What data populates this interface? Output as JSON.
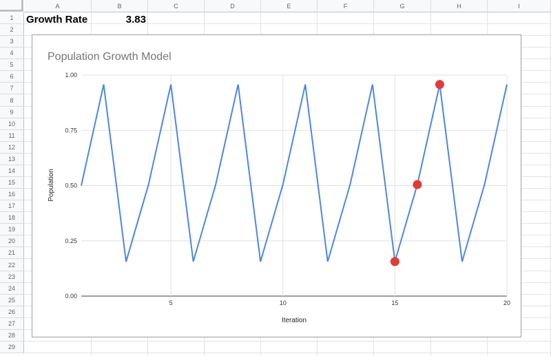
{
  "sheet": {
    "columns": [
      "A",
      "B",
      "C",
      "D",
      "E",
      "F",
      "G",
      "H",
      "I"
    ],
    "rows": [
      "1",
      "2",
      "3",
      "4",
      "5",
      "6",
      "7",
      "8",
      "9",
      "10",
      "11",
      "12",
      "13",
      "14",
      "15",
      "16",
      "17",
      "18",
      "19",
      "20",
      "21",
      "22",
      "23",
      "24",
      "25",
      "26",
      "27",
      "28",
      "29"
    ],
    "cells": {
      "A1": "Growth Rate",
      "B1": "3.83"
    }
  },
  "chart_data": {
    "type": "line",
    "title": "Population Growth Model",
    "xlabel": "Iteration",
    "ylabel": "Population",
    "xlim": [
      1,
      20
    ],
    "ylim": [
      0,
      1
    ],
    "x_ticks": [
      5,
      10,
      15,
      20
    ],
    "y_ticks": [
      "0.00",
      "0.25",
      "0.50",
      "0.75",
      "1.00"
    ],
    "grid": true,
    "legend": "none",
    "series": [
      {
        "name": "Population",
        "color": "#4a86e8",
        "x": [
          1,
          2,
          3,
          4,
          5,
          6,
          7,
          8,
          9,
          10,
          11,
          12,
          13,
          14,
          15,
          16,
          17,
          18,
          19,
          20
        ],
        "values": [
          0.5,
          0.9575,
          0.1559,
          0.504,
          0.9574,
          0.1562,
          0.5047,
          0.9574,
          0.1561,
          0.5045,
          0.9574,
          0.1561,
          0.5045,
          0.9574,
          0.1561,
          0.5045,
          0.9574,
          0.1561,
          0.5045,
          0.9574
        ]
      }
    ],
    "highlighted_points": {
      "color": "#e53935",
      "x": [
        15,
        16,
        17
      ],
      "values": [
        0.1561,
        0.5045,
        0.9574
      ]
    }
  }
}
